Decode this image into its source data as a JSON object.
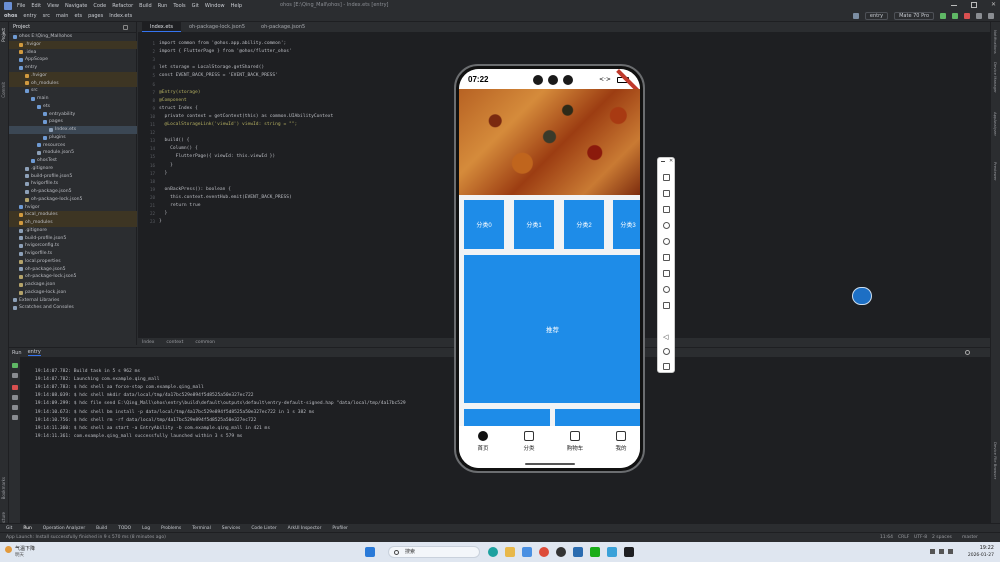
{
  "menu": {
    "items": [
      "File",
      "Edit",
      "View",
      "Navigate",
      "Code",
      "Refactor",
      "Build",
      "Run",
      "Tools",
      "Git",
      "Window",
      "Help"
    ],
    "window_title": "ohos [E:\\Qing_Mall\\ohos] - Index.ets [entry]"
  },
  "breadcrumb": [
    "ohos",
    "entry",
    "src",
    "main",
    "ets",
    "pages",
    "Index.ets"
  ],
  "toolbar": {
    "module": "entry",
    "device": "Mate 70 Pro"
  },
  "project": {
    "title": "Project",
    "tree": [
      {
        "label": "ohos  E:\\Qing_Mall\\ohos",
        "indent": 0,
        "color": "#6f9bd4",
        "state": ""
      },
      {
        "label": ".hvigor",
        "indent": 1,
        "color": "#d19a3f",
        "state": "exc"
      },
      {
        "label": ".idea",
        "indent": 1,
        "color": "#d19a3f",
        "state": ""
      },
      {
        "label": "AppScope",
        "indent": 1,
        "color": "#6f9bd4",
        "state": ""
      },
      {
        "label": "entry",
        "indent": 1,
        "color": "#6f9bd4",
        "state": ""
      },
      {
        "label": ".hvigor",
        "indent": 2,
        "color": "#d19a3f",
        "state": "exc"
      },
      {
        "label": "oh_modules",
        "indent": 2,
        "color": "#d19a3f",
        "state": "exc"
      },
      {
        "label": "src",
        "indent": 2,
        "color": "#6f9bd4",
        "state": ""
      },
      {
        "label": "main",
        "indent": 3,
        "color": "#6f9bd4",
        "state": ""
      },
      {
        "label": "ets",
        "indent": 4,
        "color": "#6f9bd4",
        "state": ""
      },
      {
        "label": "entryability",
        "indent": 5,
        "color": "#6f9bd4",
        "state": ""
      },
      {
        "label": "pages",
        "indent": 5,
        "color": "#6f9bd4",
        "state": ""
      },
      {
        "label": "Index.ets",
        "indent": 6,
        "color": "#8da0b8",
        "state": ""
      },
      {
        "label": "plugins",
        "indent": 5,
        "color": "#6f9bd4",
        "state": ""
      },
      {
        "label": "resources",
        "indent": 4,
        "color": "#6f9bd4",
        "state": ""
      },
      {
        "label": "module.json5",
        "indent": 4,
        "color": "#8da0b8",
        "state": ""
      },
      {
        "label": "ohosTest",
        "indent": 3,
        "color": "#6f9bd4",
        "state": ""
      },
      {
        "label": ".gitignore",
        "indent": 2,
        "color": "#8da0b8",
        "state": ""
      },
      {
        "label": "build-profile.json5",
        "indent": 2,
        "color": "#8da0b8",
        "state": ""
      },
      {
        "label": "hvigorfile.ts",
        "indent": 2,
        "color": "#8da0b8",
        "state": ""
      },
      {
        "label": "oh-package.json5",
        "indent": 2,
        "color": "#8da0b8",
        "state": ""
      },
      {
        "label": "oh-package-lock.json5",
        "indent": 2,
        "color": "#b4a36a",
        "state": ""
      },
      {
        "label": "hvigor",
        "indent": 1,
        "color": "#6f9bd4",
        "state": ""
      },
      {
        "label": "local_modules",
        "indent": 1,
        "color": "#d19a3f",
        "state": "exc"
      },
      {
        "label": "oh_modules",
        "indent": 1,
        "color": "#d19a3f",
        "state": "exc"
      },
      {
        "label": ".gitignore",
        "indent": 1,
        "color": "#8da0b8",
        "state": ""
      },
      {
        "label": "build-profile.json5",
        "indent": 1,
        "color": "#8da0b8",
        "state": ""
      },
      {
        "label": "hvigorconfig.ts",
        "indent": 1,
        "color": "#8da0b8",
        "state": ""
      },
      {
        "label": "hvigorfile.ts",
        "indent": 1,
        "color": "#8da0b8",
        "state": ""
      },
      {
        "label": "local.properties",
        "indent": 1,
        "color": "#b4a36a",
        "state": ""
      },
      {
        "label": "oh-package.json5",
        "indent": 1,
        "color": "#8da0b8",
        "state": ""
      },
      {
        "label": "oh-package-lock.json5",
        "indent": 1,
        "color": "#b4a36a",
        "state": ""
      },
      {
        "label": "package.json",
        "indent": 1,
        "color": "#b4a36a",
        "state": ""
      },
      {
        "label": "package-lock.json",
        "indent": 1,
        "color": "#b4a36a",
        "state": ""
      },
      {
        "label": "External Libraries",
        "indent": 0,
        "color": "#8da0b8",
        "state": ""
      },
      {
        "label": "Scratches and Consoles",
        "indent": 0,
        "color": "#8da0b8",
        "state": ""
      }
    ]
  },
  "tabs": [
    "Index.ets",
    "oh-package-lock.json5",
    "oh-package.json5"
  ],
  "editor": {
    "lines": [
      "import common from '@ohos.app.ability.common';",
      "import { FlutterPage } from '@ohos/flutter_ohos'",
      "",
      "let storage = LocalStorage.getShared()",
      "const EVENT_BACK_PRESS = 'EVENT_BACK_PRESS'",
      "",
      "@Entry(storage)",
      "@Component",
      "struct Index {",
      "  private context = getContext(this) as common.UIAbilityContext",
      "  @LocalStorageLink('viewId') viewId: string = \"\";",
      "",
      "  build() {",
      "    Column() {",
      "      FlutterPage({ viewId: this.viewId })",
      "    }",
      "  }",
      "",
      "  onBackPress(): boolean {",
      "    this.context.eventHub.emit(EVENT_BACK_PRESS)",
      "    return true",
      "  }",
      "}"
    ],
    "breadcrumbs": [
      "Index",
      "context",
      "common"
    ]
  },
  "run": {
    "label": "Run",
    "config": "entry",
    "console": [
      "19:14:07.782: Build task in 5 s 962 ms",
      "19:14:07.782: Launching com.example.qing_mall",
      "19:14:07.783: $ hdc shell aa force-stop com.example.qing_mall",
      "19:14:08.039: $ hdc shell mkdir data/local/tmp/4a17bc529e894f5d8525a50e327ec722",
      "19:14:09.299: $ hdc file send E:\\Qing_Mall\\ohos\\entry\\build\\default\\outputs\\default\\entry-default-signed.hap \"data/local/tmp/4a17bc529",
      "19:14:10.673: $ hdc shell bm install -p data/local/tmp/4a17bc529e894f5d8525a50e327ec722 in 1 s 382 ms",
      "19:14:10.756: $ hdc shell rm -rf data/local/tmp/4a17bc529e894f5d8525a50e327ec722",
      "19:14:11.360: $ hdc shell aa start -a EntryAbility -b com.example.qing_mall in 421 ms",
      "19:14:11.361: com.example.qing_mall successfully launched within 3 s 579 ms"
    ]
  },
  "bottom_tools": [
    "Git",
    "Run",
    "Operation Analyzer",
    "Build",
    "TODO",
    "Log",
    "Problems",
    "Terminal",
    "Services",
    "Code Linter",
    "ArkUI Inspector",
    "Profiler"
  ],
  "status": {
    "message": "App Launch: Install successfully finished in 9 s 570 ms (8 minutes ago)",
    "position": "11:64",
    "line_sep": "CRLF",
    "encoding": "UTF-8",
    "indent": "2 spaces",
    "branch": "master"
  },
  "taskbar": {
    "weather": "气温下降",
    "weather_sub": "明天",
    "search_placeholder": "搜索",
    "time": "19:22",
    "date": "2026-01-27"
  },
  "phone": {
    "clock": "07:22",
    "categories": [
      "分类0",
      "分类1",
      "分类2",
      "分类3"
    ],
    "recommend": "推荐",
    "nav": [
      "首页",
      "分类",
      "购物车",
      "我的"
    ],
    "active_nav": 0
  },
  "colors": {
    "accent": "#1e8ce8",
    "ide_bg": "#1e1f22",
    "panel_bg": "#2b2d30"
  }
}
